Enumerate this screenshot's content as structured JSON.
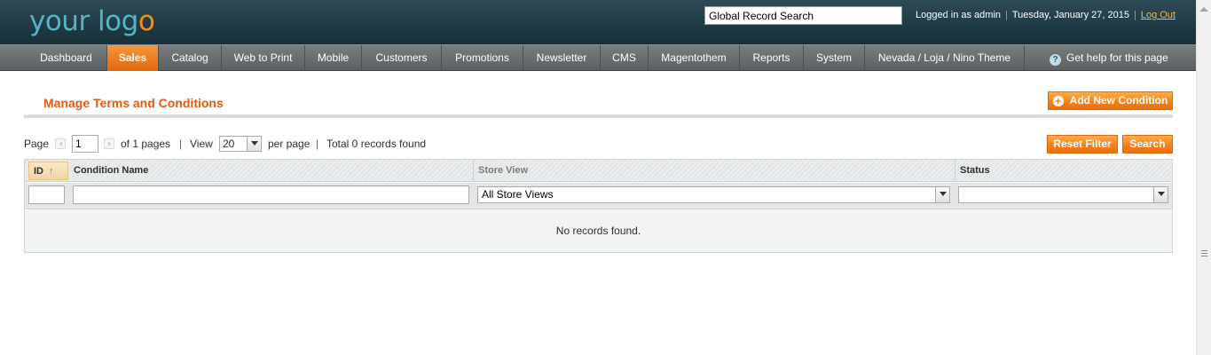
{
  "header": {
    "logo_main": "your log",
    "logo_accent": "o",
    "search_value": "Global Record Search",
    "logged_in_text": "Logged in as admin",
    "date": "Tuesday, January 27, 2015",
    "logout_label": "Log Out"
  },
  "nav": {
    "items": [
      {
        "label": "Dashboard",
        "active": false
      },
      {
        "label": "Sales",
        "active": true
      },
      {
        "label": "Catalog",
        "active": false
      },
      {
        "label": "Web to Print",
        "active": false
      },
      {
        "label": "Mobile",
        "active": false
      },
      {
        "label": "Customers",
        "active": false
      },
      {
        "label": "Promotions",
        "active": false
      },
      {
        "label": "Newsletter",
        "active": false
      },
      {
        "label": "CMS",
        "active": false
      },
      {
        "label": "Magentothem",
        "active": false
      },
      {
        "label": "Reports",
        "active": false
      },
      {
        "label": "System",
        "active": false
      },
      {
        "label": "Nevada / Loja / Nino Theme",
        "active": false
      }
    ],
    "help_label": "Get help for this page",
    "help_icon": "?"
  },
  "page": {
    "title": "Manage Terms and Conditions",
    "add_button_label": "Add New Condition",
    "add_icon": "+",
    "reset_filter_label": "Reset Filter",
    "search_button_label": "Search"
  },
  "pager": {
    "page_label": "Page",
    "page_value": "1",
    "of_pages": "of 1 pages",
    "sep": "|",
    "view_label": "View",
    "per_page_value": "20",
    "per_page_label": "per page",
    "total_text": "Total 0 records found"
  },
  "grid": {
    "columns": [
      {
        "label": "ID"
      },
      {
        "label": "Condition Name"
      },
      {
        "label": "Store View"
      },
      {
        "label": "Status"
      }
    ],
    "sort_icon": "↑",
    "store_filter_value": "All Store Views",
    "status_filter_value": "",
    "empty_message": "No records found."
  },
  "colors": {
    "accent": "#f47f16",
    "title": "#e05a0f",
    "header_bg": "#1f3a44",
    "nav_bg": "#5b6164"
  }
}
